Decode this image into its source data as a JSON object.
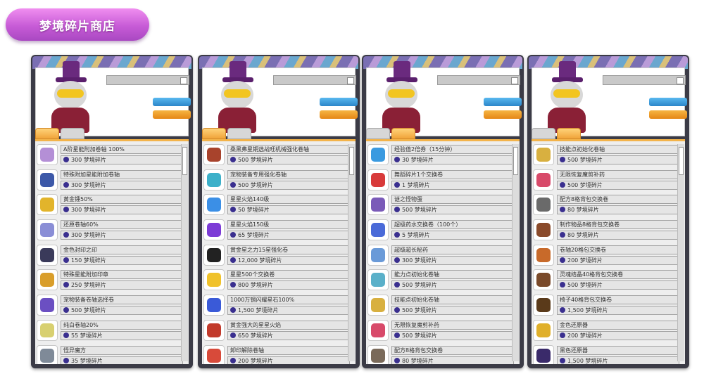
{
  "page_title": "梦境碎片商店",
  "colors": {
    "title_pill": "#c75bd6",
    "panel_frame": "#3b3b46",
    "tab_active": "#f0a43a",
    "btn_blue": "#2b86c9",
    "btn_orange": "#e58716",
    "coin": "#3a2f8f"
  },
  "currency": "梦境碎片",
  "panels": [
    {
      "items": [
        {
          "name": "A阶星能附加卷轴 100%",
          "price": "300",
          "icon": "scroll-icon",
          "color": "#b48fd6"
        },
        {
          "name": "特殊附加星能附加卷轴",
          "price": "300",
          "icon": "scroll-icon",
          "color": "#3c58a8"
        },
        {
          "name": "黄金锤50%",
          "price": "300",
          "icon": "hammer-icon",
          "color": "#e2b42b"
        },
        {
          "name": "还原卷轴60%",
          "price": "300",
          "icon": "scroll-icon",
          "color": "#8a8ed6"
        },
        {
          "name": "金色封印之印",
          "price": "150",
          "icon": "seal-icon",
          "color": "#3a3a5a"
        },
        {
          "name": "特殊星能附加印章",
          "price": "250",
          "icon": "stamp-icon",
          "color": "#d99e2b"
        },
        {
          "name": "宠物装备卷轴选择卷",
          "price": "500",
          "icon": "scroll-icon",
          "color": "#6b4fc2"
        },
        {
          "name": "纯白卷轴20%",
          "price": "55",
          "icon": "scroll-icon",
          "color": "#d8d070"
        },
        {
          "name": "怪异魔方",
          "price": "35",
          "icon": "cube-icon",
          "color": "#7f8a98"
        }
      ]
    },
    {
      "items": [
        {
          "name": "桑黑弗星期选战旺机械强化卷轴",
          "price": "500",
          "icon": "scroll-icon",
          "color": "#a8432c"
        },
        {
          "name": "宠物装备专用强化卷轴",
          "price": "500",
          "icon": "scroll-icon",
          "color": "#3cb0c9"
        },
        {
          "name": "星星火焰140级",
          "price": "50",
          "icon": "flame-icon",
          "color": "#3b8fe6"
        },
        {
          "name": "星星火焰150级",
          "price": "65",
          "icon": "flame-icon",
          "color": "#7c3bd6"
        },
        {
          "name": "黄金星之力15星强化卷",
          "price": "12,000",
          "icon": "orb-icon",
          "color": "#222222"
        },
        {
          "name": "星星500个交换卷",
          "price": "800",
          "icon": "star-icon",
          "color": "#f0c22b"
        },
        {
          "name": "1000万钢闪耀星石100%",
          "price": "1,500",
          "icon": "gem-icon",
          "color": "#3a5ad8"
        },
        {
          "name": "黄金强大的星星火焰",
          "price": "650",
          "icon": "flame-icon",
          "color": "#c23a2b"
        },
        {
          "name": "卸印解除卷轴",
          "price": "200",
          "icon": "scroll-icon",
          "color": "#d84a3a"
        }
      ]
    },
    {
      "items": [
        {
          "name": "经验值2倍券（15分钟）",
          "price": "30",
          "icon": "exp-icon",
          "color": "#3a9ae0"
        },
        {
          "name": "舞蹈碎片1个交换卷",
          "price": "1",
          "icon": "shard-icon",
          "color": "#d83a3a"
        },
        {
          "name": "谜之怪物蛋",
          "price": "500",
          "icon": "egg-icon",
          "color": "#7a5ab8"
        },
        {
          "name": "超级药水交换卷（100个）",
          "price": "5",
          "icon": "potion-icon",
          "color": "#4a6ad8"
        },
        {
          "name": "超级超长秘药",
          "price": "300",
          "icon": "potion-icon",
          "color": "#6a9ad8"
        },
        {
          "name": "能力点初始化卷轴",
          "price": "500",
          "icon": "scroll-icon",
          "color": "#5ab0c9"
        },
        {
          "name": "技能点初始化卷轴",
          "price": "500",
          "icon": "scroll-icon",
          "color": "#d8b040"
        },
        {
          "name": "无限恢复魔剪补药",
          "price": "500",
          "icon": "medicine-icon",
          "color": "#d84a6a"
        },
        {
          "name": "配方8格背包交换卷",
          "price": "80",
          "icon": "chest-icon",
          "color": "#7a6a5a"
        }
      ]
    },
    {
      "items": [
        {
          "name": "技能点初始化卷轴",
          "price": "500",
          "icon": "scroll-icon",
          "color": "#d8b040"
        },
        {
          "name": "无限恢复魔剪补药",
          "price": "500",
          "icon": "medicine-icon",
          "color": "#d84a6a"
        },
        {
          "name": "配方8格背包交换卷",
          "price": "80",
          "icon": "chest-icon",
          "color": "#6a6a6a"
        },
        {
          "name": "制作物品8格背包交换卷",
          "price": "80",
          "icon": "bag-icon",
          "color": "#8a4a2a"
        },
        {
          "name": "卷轴20格包交换卷",
          "price": "200",
          "icon": "bag-icon",
          "color": "#c86a2a"
        },
        {
          "name": "灵魂结晶40格背包交换卷",
          "price": "500",
          "icon": "chest-icon",
          "color": "#7a4a2a"
        },
        {
          "name": "椅子40格背包交换卷",
          "price": "1,500",
          "icon": "chest-icon",
          "color": "#5a3a1a"
        },
        {
          "name": "金色还原器",
          "price": "200",
          "icon": "restorer-icon",
          "color": "#e0b02b"
        },
        {
          "name": "黑色还原器",
          "price": "1,500",
          "icon": "restorer-icon",
          "color": "#3a2a6a"
        }
      ]
    }
  ]
}
